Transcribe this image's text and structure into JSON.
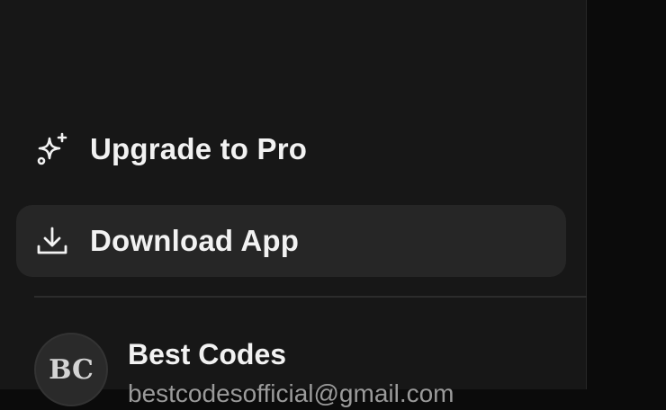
{
  "sidebar": {
    "upgrade": {
      "label": "Upgrade to Pro",
      "icon": "sparkles-icon"
    },
    "download": {
      "label": "Download App",
      "icon": "download-icon"
    },
    "user": {
      "initials": "BC",
      "name": "Best Codes",
      "email": "bestcodesofficial@gmail.com"
    }
  },
  "colors": {
    "sidebar_bg": "#171717",
    "selected_item_bg": "#262626",
    "text": "#f2f2f2",
    "muted_text": "#9a9a9a"
  }
}
